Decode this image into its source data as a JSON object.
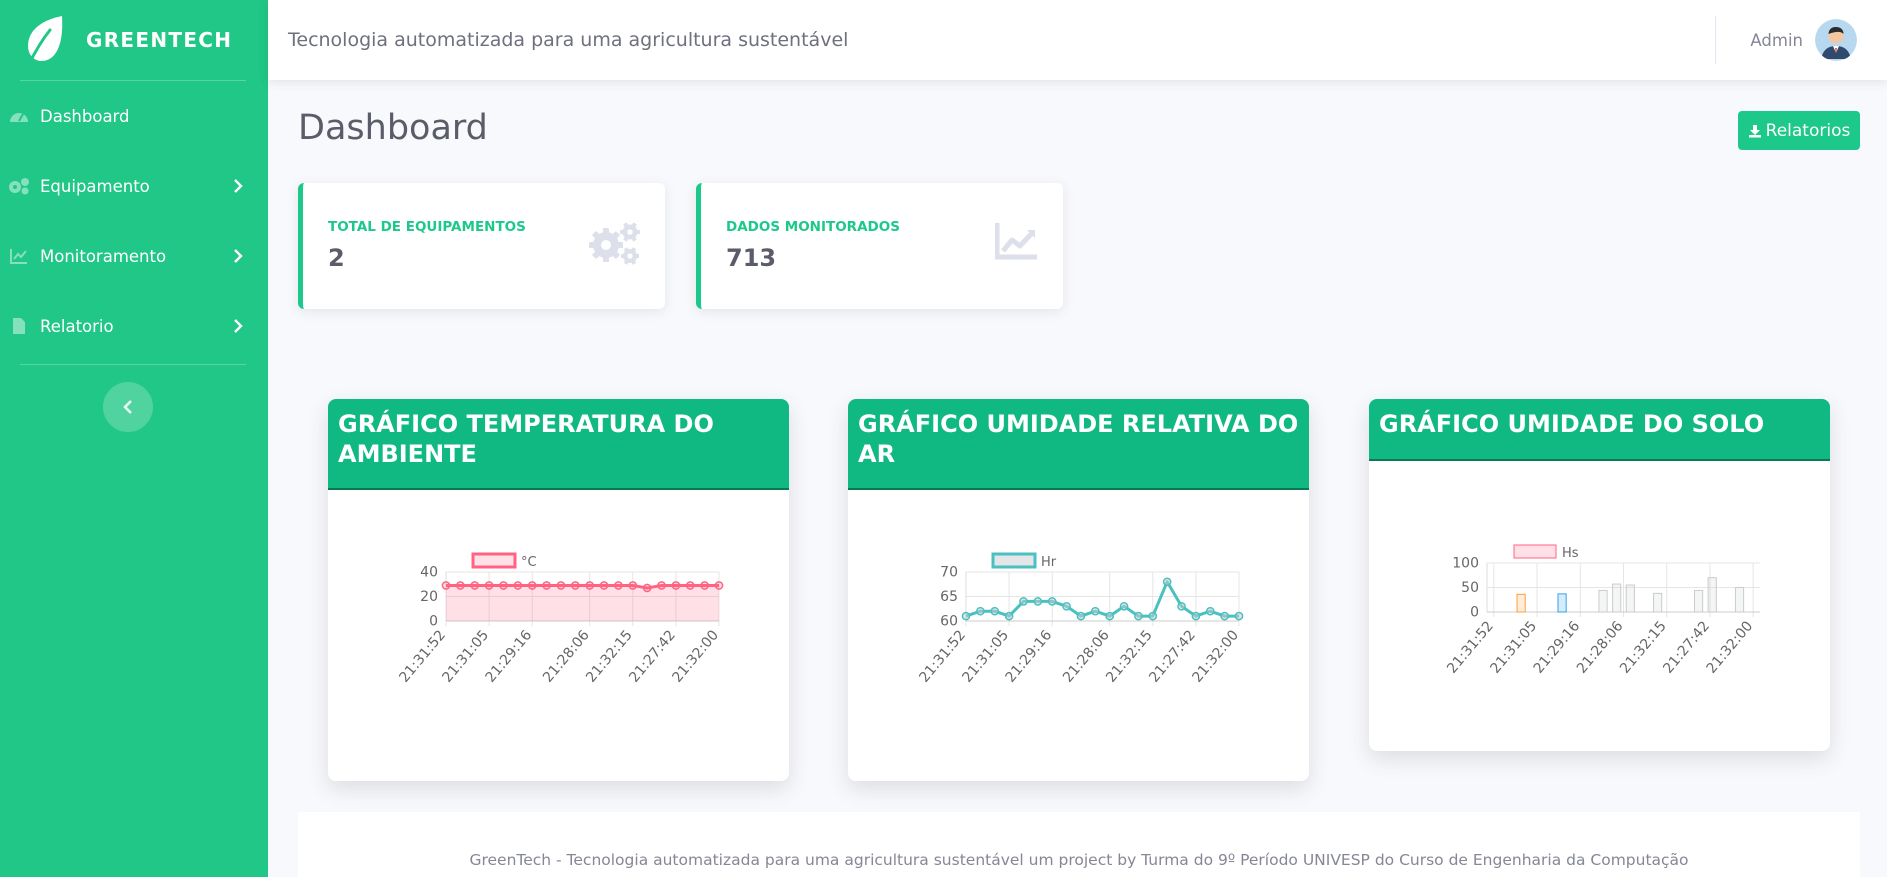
{
  "brand": {
    "name": "GREENTECH"
  },
  "sidebar": {
    "items": [
      {
        "label": "Dashboard",
        "icon": "tachometer-icon",
        "has_children": false
      },
      {
        "label": "Equipamento",
        "icon": "cogs-icon",
        "has_children": true
      },
      {
        "label": "Monitoramento",
        "icon": "chart-line-icon",
        "has_children": true
      },
      {
        "label": "Relatorio",
        "icon": "file-icon",
        "has_children": true
      }
    ],
    "toggle_icon": "chevron-left-icon"
  },
  "topbar": {
    "subtitle": "Tecnologia automatizada para uma agricultura sustentável",
    "user_name": "Admin"
  },
  "page": {
    "title": "Dashboard",
    "report_button": "Relatorios"
  },
  "stats": [
    {
      "label": "TOTAL DE EQUIPAMENTOS",
      "value": "2",
      "icon": "cogs-icon"
    },
    {
      "label": "DADOS MONITORADOS",
      "value": "713",
      "icon": "chart-area-icon"
    }
  ],
  "colors": {
    "sidebar": "#20c786",
    "accent": "#1cc88a",
    "chart_header": "#10b981",
    "temp_line": "#ff6384",
    "hr_line": "#4bc0c0"
  },
  "chart_data": [
    {
      "type": "area",
      "title": "GRÁFICO TEMPERATURA DO AMBIENTE",
      "legend": [
        "°C"
      ],
      "x_tick_labels": [
        "21:31:52",
        "21:31:05",
        "21:29:16",
        "21:28:06",
        "21:32:15",
        "21:27:42",
        "21:32:00"
      ],
      "ylim": [
        0,
        40
      ],
      "y_ticks": [
        0,
        20,
        40
      ],
      "series": [
        {
          "name": "°C",
          "values": [
            29,
            29,
            29,
            29,
            29,
            29,
            29,
            29,
            29,
            29,
            29,
            29,
            29,
            29,
            27,
            29,
            29,
            29,
            29,
            29
          ]
        }
      ]
    },
    {
      "type": "line",
      "title": "GRÁFICO UMIDADE RELATIVA DO AR",
      "legend": [
        "Hr"
      ],
      "x_tick_labels": [
        "21:31:52",
        "21:31:05",
        "21:29:16",
        "21:28:06",
        "21:32:15",
        "21:27:42",
        "21:32:00"
      ],
      "ylim": [
        60,
        70
      ],
      "y_ticks": [
        60,
        65,
        70
      ],
      "series": [
        {
          "name": "Hr",
          "values": [
            61,
            62,
            62,
            61,
            64,
            64,
            64,
            63,
            61,
            62,
            61,
            63,
            61,
            61,
            68,
            63,
            61,
            62,
            61,
            61
          ]
        }
      ]
    },
    {
      "type": "bar",
      "title": "GRÁFICO UMIDADE DO SOLO",
      "legend": [
        "Hs"
      ],
      "x_tick_labels": [
        "21:31:52",
        "21:31:05",
        "21:29:16",
        "21:28:06",
        "21:32:15",
        "21:27:42",
        "21:32:00"
      ],
      "ylim": [
        0,
        100
      ],
      "y_ticks": [
        0,
        50,
        100
      ],
      "series": [
        {
          "name": "Hs",
          "values": [
            0,
            0,
            36,
            0,
            0,
            37,
            0,
            0,
            44,
            57,
            55,
            0,
            38,
            0,
            0,
            44,
            70,
            0,
            50,
            0
          ]
        }
      ],
      "bar_colors": [
        "#ff6384",
        "#ff9f40",
        "#ff9f40",
        "#ffcd56",
        "#4bc0c0",
        "#36a2eb",
        "#36a2eb",
        "#9966ff",
        "#c9cbcf",
        "#c9cbcf",
        "#c9cbcf",
        "#c9cbcf",
        "#c9cbcf",
        "#c9cbcf",
        "#c9cbcf",
        "#c9cbcf",
        "#c9cbcf",
        "#c9cbcf",
        "#c9cbcf",
        "#c9cbcf"
      ]
    }
  ],
  "footer": {
    "text": "GreenTech - Tecnologia automatizada para uma agricultura sustentável um project by Turma do 9º Período UNIVESP do Curso de Engenharia da Computação"
  }
}
